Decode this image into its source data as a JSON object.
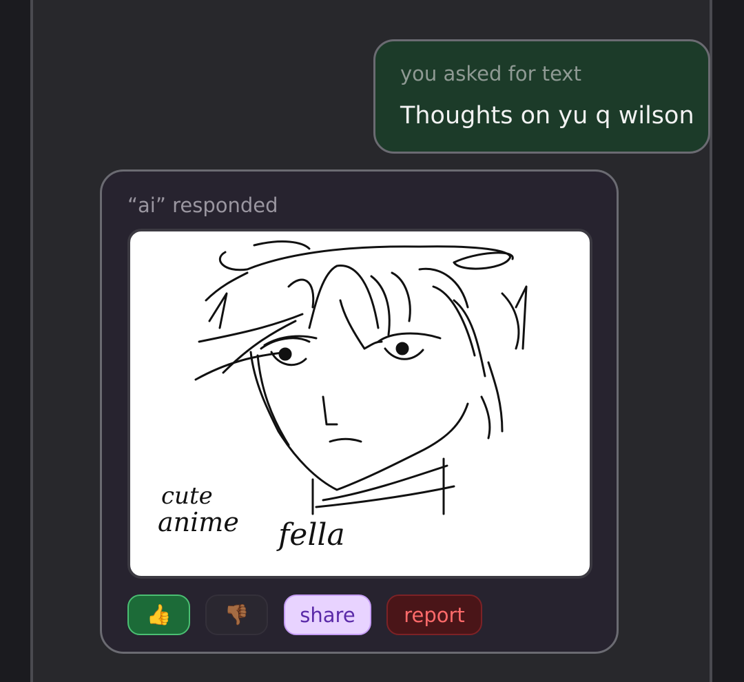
{
  "user_message": {
    "label": "you asked for text",
    "text": "Thoughts on yu q wilson"
  },
  "ai_response": {
    "label": "“ai” responded",
    "image_caption": "cute anime fella",
    "actions": {
      "like_icon": "thumbs-up-icon",
      "like_glyph": "👍",
      "dislike_icon": "thumbs-down-icon",
      "dislike_glyph": "👎🏾",
      "share_label": "share",
      "report_label": "report"
    }
  },
  "colors": {
    "user_bubble": "#1c3b29",
    "ai_card": "#27232f",
    "like_bg": "#1c6b38",
    "share_bg": "#e8d3ff",
    "report_bg": "#4a1518"
  }
}
